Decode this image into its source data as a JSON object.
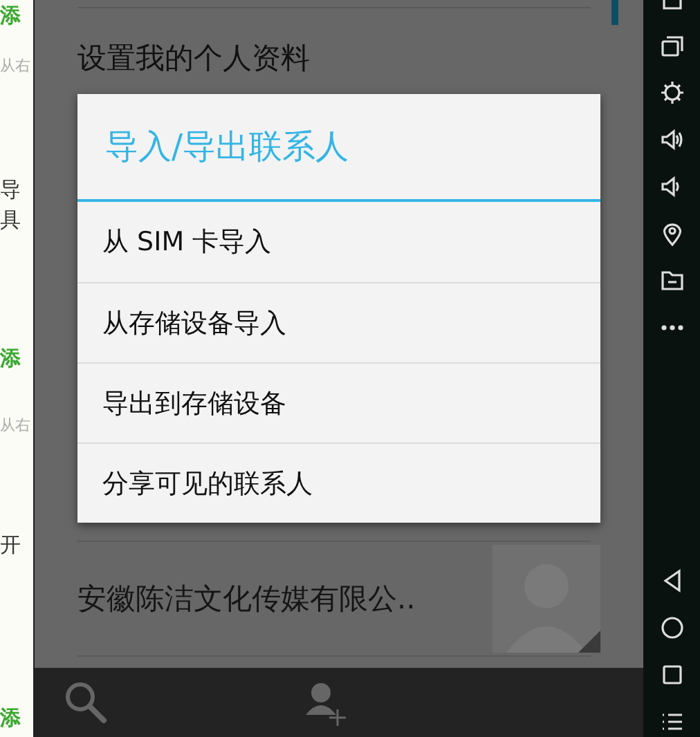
{
  "web_page_strip": [
    {
      "text": "添",
      "kind": "green"
    },
    {
      "text": "从右",
      "kind": "hint"
    },
    {
      "text": "导",
      "kind": "plain"
    },
    {
      "text": "具",
      "kind": "plain"
    },
    {
      "text": "添",
      "kind": "green"
    },
    {
      "text": "从右",
      "kind": "hint"
    },
    {
      "text": "开",
      "kind": "plain"
    },
    {
      "text": "添",
      "kind": "green"
    }
  ],
  "phone": {
    "profile_row": "设置我的个人资料",
    "contact_row": "安徽陈洁文化传媒有限公..",
    "dialog": {
      "title": "导入/导出联系人",
      "items": [
        "从 SIM 卡导入",
        "从存储设备导入",
        "导出到存储设备",
        "分享可见的联系人"
      ]
    }
  }
}
